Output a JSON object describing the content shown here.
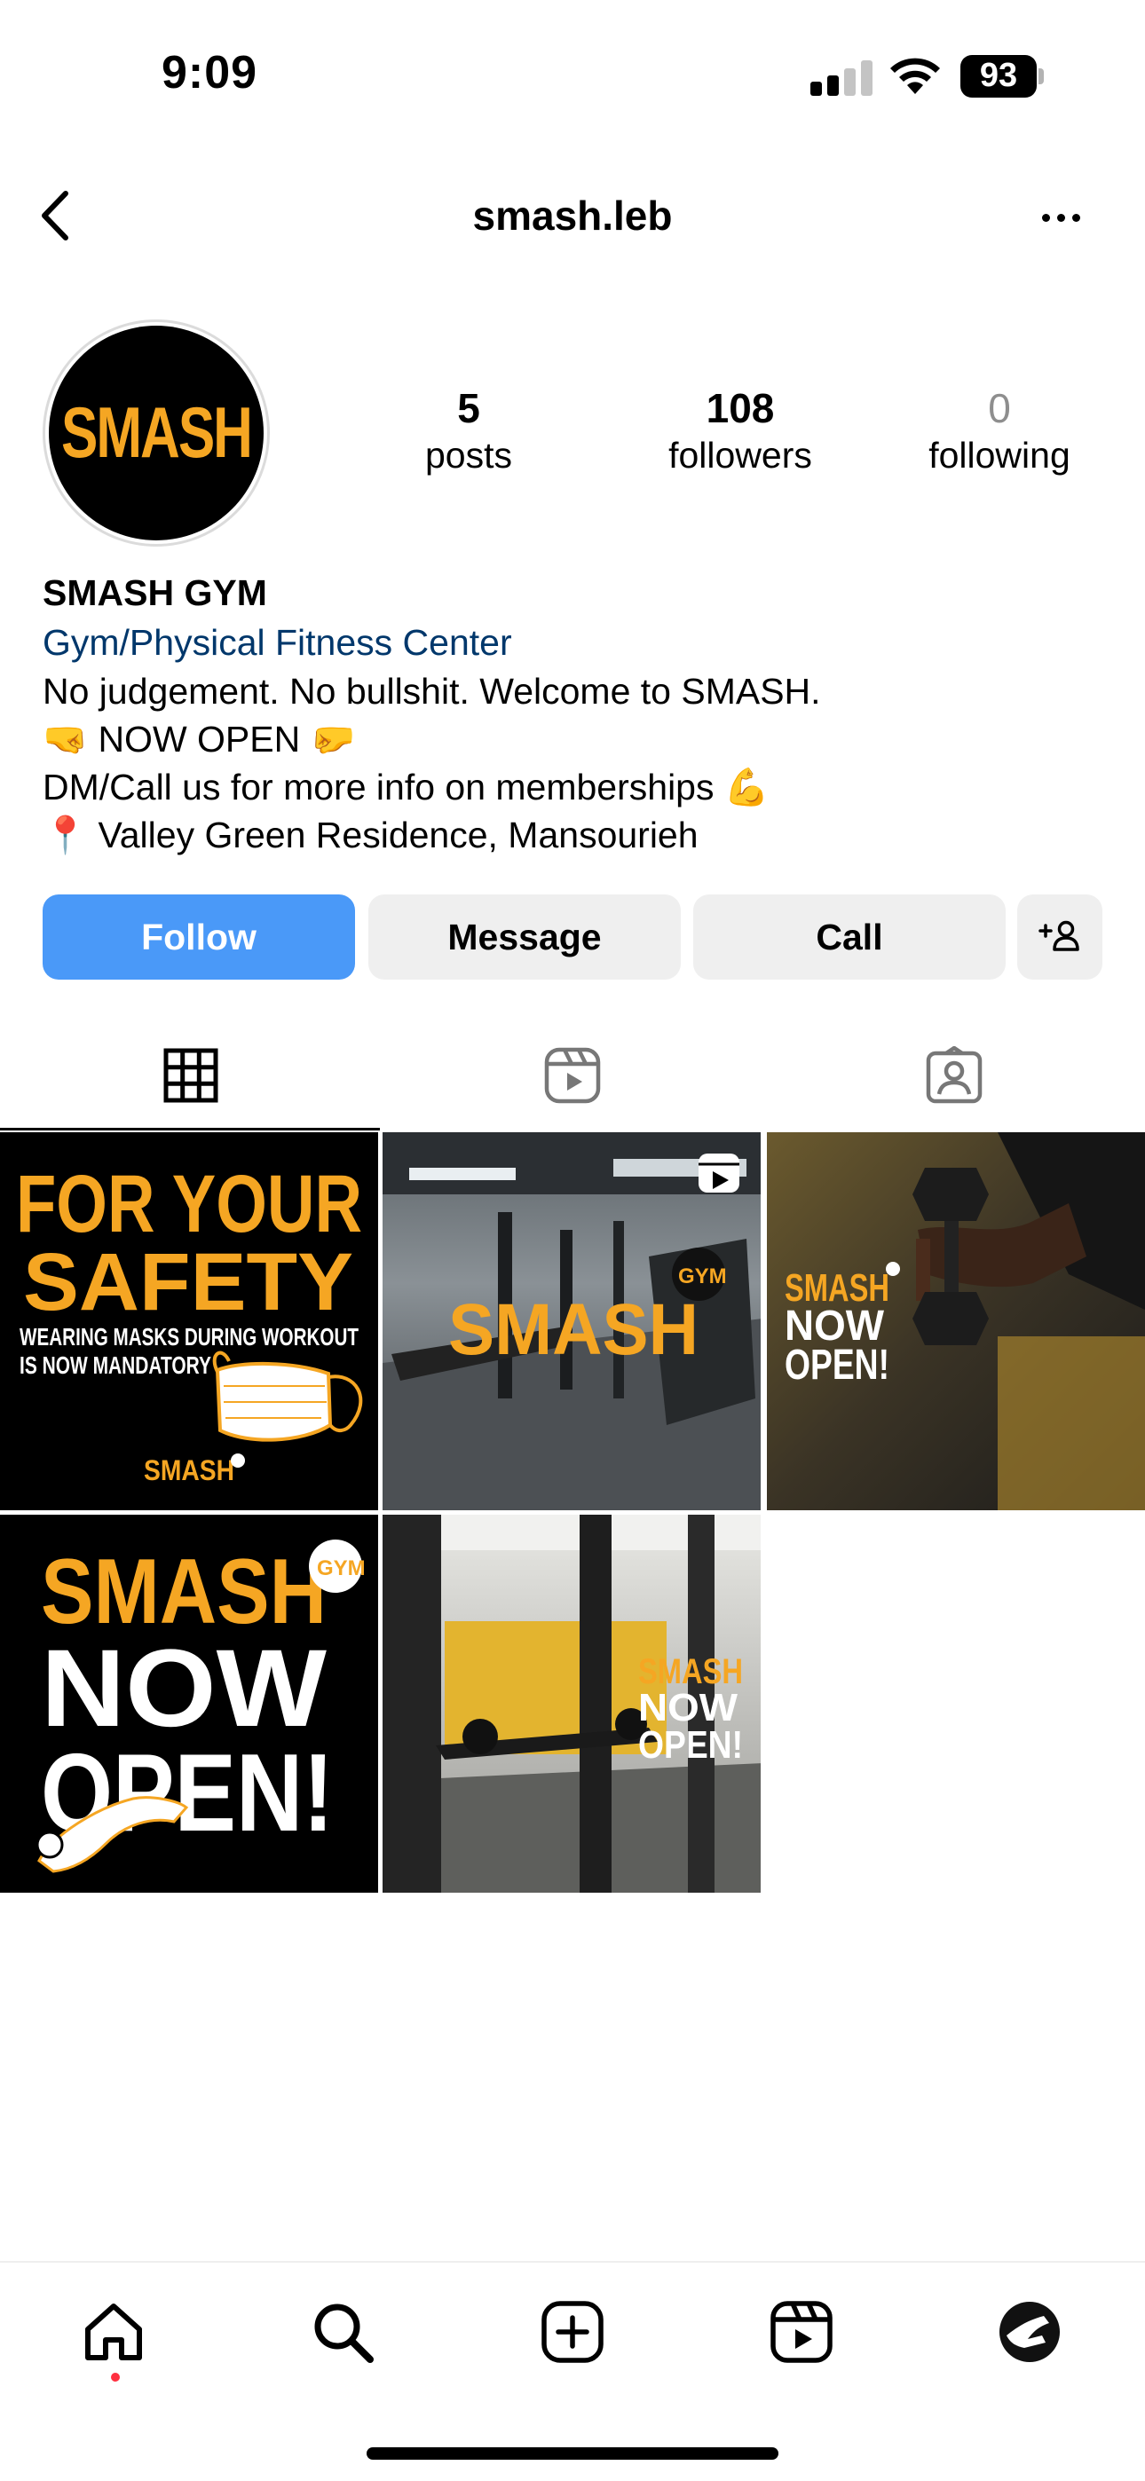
{
  "status_bar": {
    "time": "9:09",
    "battery": "93"
  },
  "header": {
    "username": "smash.leb"
  },
  "profile": {
    "avatar_text": "SMASH",
    "stats": [
      {
        "value": "5",
        "label": "posts"
      },
      {
        "value": "108",
        "label": "followers"
      },
      {
        "value": "0",
        "label": "following"
      }
    ],
    "name": "SMASH GYM",
    "category": "Gym/Physical Fitness Center",
    "bio_lines": [
      "No judgement. No bullshit. Welcome to SMASH.",
      "🤜 NOW OPEN 🤛",
      "DM/Call us for more info on memberships 💪",
      "📍 Valley Green Residence, Mansourieh"
    ]
  },
  "actions": {
    "follow": "Follow",
    "message": "Message",
    "call": "Call"
  },
  "tabs": [
    {
      "name": "posts",
      "icon": "grid-icon",
      "active": true
    },
    {
      "name": "reels",
      "icon": "reels-icon",
      "active": false
    },
    {
      "name": "tagged",
      "icon": "tagged-icon",
      "active": false
    }
  ],
  "posts": {
    "post1": {
      "line1": "FOR YOUR",
      "line2": "SAFETY",
      "line3": "WEARING MASKS DURING WORKOUT",
      "line4": "IS NOW MANDATORY",
      "brand": "SMASH"
    },
    "post2": {
      "brand": "SMASH",
      "badge": "GYM"
    },
    "post3": {
      "line1": "SMASH",
      "line2": "NOW",
      "line3": "OPEN!"
    },
    "post4": {
      "line1": "SMASH",
      "line2": "NOW",
      "line3": "OPEN!",
      "badge": "GYM"
    },
    "post5": {
      "line1": "SMASH",
      "line2": "NOW",
      "line3": "OPEN!"
    }
  },
  "colors": {
    "brand_yellow": "#f5a623",
    "follow_blue": "#4a99f8",
    "category_link": "#00376b",
    "button_gray": "#efefef"
  },
  "bottom_nav": [
    "home-icon",
    "search-icon",
    "create-icon",
    "reels-icon",
    "profile-avatar"
  ]
}
